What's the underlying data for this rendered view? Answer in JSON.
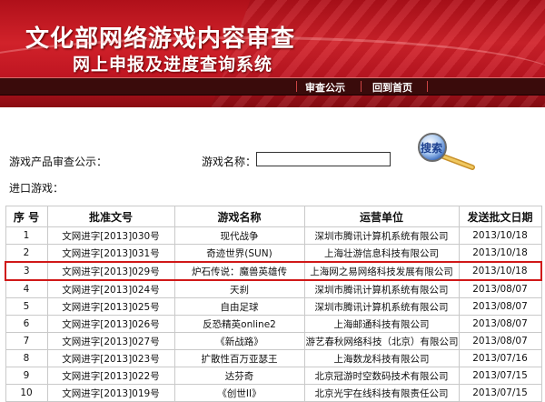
{
  "header": {
    "title": "文化部网络游戏内容审查",
    "subtitle": "网上申报及进度查询系统",
    "nav": [
      "审查公示",
      "回到首页"
    ]
  },
  "search": {
    "section_label": "游戏产品审查公示：",
    "name_label": "游戏名称：",
    "name_value": "",
    "button_label": "搜索",
    "import_label": "进口游戏："
  },
  "table": {
    "columns": [
      "序 号",
      "批准文号",
      "游戏名称",
      "运营单位",
      "发送批文日期"
    ],
    "rows": [
      [
        "1",
        "文网进字[2013]030号",
        "现代战争",
        "深圳市腾讯计算机系统有限公司",
        "2013/10/18"
      ],
      [
        "2",
        "文网进字[2013]031号",
        "奇迹世界(SUN)",
        "上海壮游信息科技有限公司",
        "2013/10/18"
      ],
      [
        "3",
        "文网进字[2013]029号",
        "炉石传说：魔兽英雄传",
        "上海网之易网络科技发展有限公司",
        "2013/10/18"
      ],
      [
        "4",
        "文网进字[2013]024号",
        "天刹",
        "深圳市腾讯计算机系统有限公司",
        "2013/08/07"
      ],
      [
        "5",
        "文网进字[2013]025号",
        "自由足球",
        "深圳市腾讯计算机系统有限公司",
        "2013/08/07"
      ],
      [
        "6",
        "文网进字[2013]026号",
        "反恐精英online2",
        "上海邮通科技有限公司",
        "2013/08/07"
      ],
      [
        "7",
        "文网进字[2013]027号",
        "《新战路》",
        "游艺春秋网络科技（北京）有限公司",
        "2013/08/07"
      ],
      [
        "8",
        "文网进字[2013]023号",
        "扩散性百万亚瑟王",
        "上海数龙科技有限公司",
        "2013/07/16"
      ],
      [
        "9",
        "文网进字[2013]022号",
        "达芬奇",
        "北京冠游时空数码技术有限公司",
        "2013/07/15"
      ],
      [
        "10",
        "文网进字[2013]019号",
        "《创世II》",
        "北京光宇在线科技有限责任公司",
        "2013/07/15"
      ]
    ],
    "highlighted_row": 2
  },
  "colors": {
    "banner_red": "#c01622",
    "highlight": "#d01818",
    "nav_bg": "#3a0b0b"
  }
}
